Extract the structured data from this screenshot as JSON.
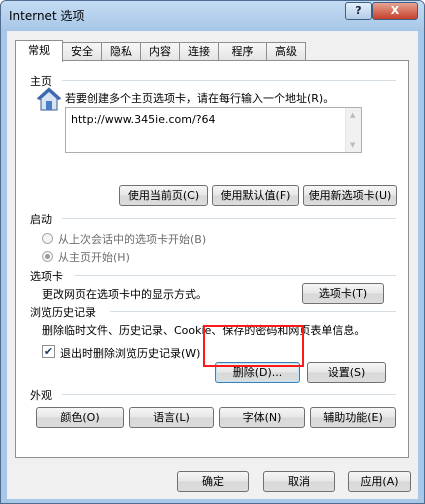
{
  "window": {
    "title": "Internet 选项",
    "help_label": "?",
    "close_label": "X"
  },
  "tabs": [
    "常规",
    "安全",
    "隐私",
    "内容",
    "连接",
    "程序",
    "高级"
  ],
  "home": {
    "heading": "主页",
    "description": "若要创建多个主页选项卡，请在每行输入一个地址(R)。",
    "url": "http://www.345ie.com/?64",
    "buttons": {
      "use_current": "使用当前页(C)",
      "use_default": "使用默认值(F)",
      "use_new_tab": "使用新选项卡(U)"
    }
  },
  "startup": {
    "heading": "启动",
    "option1": "从上次会话中的选项卡开始(B)",
    "option2": "从主页开始(H)",
    "selected": "option2"
  },
  "tabs_section": {
    "heading": "选项卡",
    "description": "更改网页在选项卡中的显示方式。",
    "button": "选项卡(T)"
  },
  "history": {
    "heading": "浏览历史记录",
    "description": "删除临时文件、历史记录、Cookie、保存的密码和网页表单信息。",
    "checkbox_label": "退出时删除浏览历史记录(W)",
    "checked": true,
    "delete_button": "删除(D)...",
    "settings_button": "设置(S)"
  },
  "appearance": {
    "heading": "外观",
    "colors": "颜色(O)",
    "languages": "语言(L)",
    "fonts": "字体(N)",
    "accessibility": "辅助功能(E)"
  },
  "footer": {
    "ok": "确定",
    "cancel": "取消",
    "apply": "应用(A)"
  },
  "colors": {
    "highlight": "#ff1a1a",
    "title_bar": "#a9c7e6",
    "close_button": "#c4402a"
  }
}
